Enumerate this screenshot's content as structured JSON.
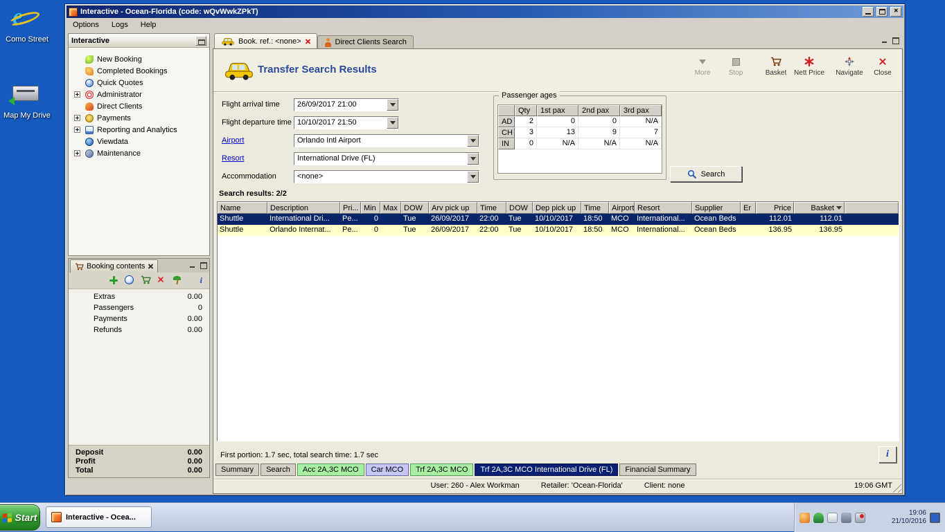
{
  "icons": {
    "info_glyph": "i"
  },
  "desktop": {
    "icons": [
      {
        "label": "Como Street"
      },
      {
        "label": "Map My Drive"
      }
    ]
  },
  "window": {
    "title": "Interactive - Ocean-Florida (code: wQvWwkZPkT)",
    "menus": [
      {
        "label": "Options"
      },
      {
        "label": "Logs"
      },
      {
        "label": "Help"
      }
    ]
  },
  "sidebar": {
    "title": "Interactive",
    "items": [
      {
        "label": "New Booking"
      },
      {
        "label": "Completed Bookings"
      },
      {
        "label": "Quick Quotes"
      },
      {
        "label": "Administrator"
      },
      {
        "label": "Direct Clients"
      },
      {
        "label": "Payments"
      },
      {
        "label": "Reporting and Analytics"
      },
      {
        "label": "Viewdata"
      },
      {
        "label": "Maintenance"
      }
    ]
  },
  "booking_panel": {
    "tab_label": "Booking contents",
    "rows": [
      {
        "label": "Extras",
        "value": "0.00"
      },
      {
        "label": "Passengers",
        "value": "0"
      },
      {
        "label": "Payments",
        "value": "0.00"
      },
      {
        "label": "Refunds",
        "value": "0.00"
      }
    ],
    "totals": [
      {
        "label": "Deposit",
        "value": "0.00"
      },
      {
        "label": "Profit",
        "value": "0.00"
      },
      {
        "label": "Total",
        "value": "0.00"
      }
    ]
  },
  "main": {
    "tabs": [
      {
        "label": "Book. ref.: <none>"
      },
      {
        "label": "Direct Clients Search"
      }
    ],
    "title": "Transfer Search Results",
    "toolbar": [
      {
        "label": "More"
      },
      {
        "label": "Stop"
      },
      {
        "label": "Basket"
      },
      {
        "label": "Nett Price"
      },
      {
        "label": "Navigate"
      },
      {
        "label": "Close"
      }
    ],
    "form": {
      "rows": [
        {
          "label": "Flight arrival time",
          "value": "26/09/2017 21:00"
        },
        {
          "label": "Flight departure time",
          "value": "10/10/2017 21:50"
        },
        {
          "label": "Airport",
          "value": "Orlando Intl Airport"
        },
        {
          "label": "Resort",
          "value": "International Drive (FL)"
        },
        {
          "label": "Accommodation",
          "value": "<none>"
        }
      ]
    },
    "passenger_ages": {
      "title": "Passenger ages",
      "columns": [
        "Qty",
        "1st pax",
        "2nd pax",
        "3rd pax"
      ],
      "rows": [
        {
          "label": "AD",
          "values": [
            "2",
            "0",
            "0",
            "N/A"
          ]
        },
        {
          "label": "CH",
          "values": [
            "3",
            "13",
            "9",
            "7"
          ]
        },
        {
          "label": "IN",
          "values": [
            "0",
            "N/A",
            "N/A",
            "N/A"
          ]
        }
      ]
    },
    "search_button": "Search",
    "results_label": "Search results: 2/2",
    "results": {
      "columns": [
        "Name",
        "Description",
        "Pri...",
        "Min",
        "Max",
        "DOW",
        "Arv pick up",
        "Time",
        "DOW",
        "Dep pick up",
        "Time",
        "Airport",
        "Resort",
        "Supplier",
        "Er",
        "Price",
        "Basket"
      ],
      "rows": [
        {
          "cells": [
            "Shuttle",
            "International Dri...",
            "Pe...",
            "0",
            "",
            "Tue",
            "26/09/2017",
            "22:00",
            "Tue",
            "10/10/2017",
            "18:50",
            "MCO",
            "International...",
            "Ocean Beds",
            "",
            "112.01",
            "112.01"
          ]
        },
        {
          "cells": [
            "Shuttle",
            "Orlando Internat...",
            "Pe...",
            "0",
            "",
            "Tue",
            "26/09/2017",
            "22:00",
            "Tue",
            "10/10/2017",
            "18:50",
            "MCO",
            "International...",
            "Ocean Beds",
            "",
            "136.95",
            "136.95"
          ]
        }
      ]
    },
    "status_text": "First portion: 1.7 sec, total search time: 1.7 sec",
    "bottom_tabs": [
      {
        "label": "Summary"
      },
      {
        "label": "Search"
      },
      {
        "label": "Acc 2A,3C MCO"
      },
      {
        "label": "Car MCO"
      },
      {
        "label": "Trf 2A,3C MCO"
      },
      {
        "label": "Trf 2A,3C MCO International Drive (FL)"
      },
      {
        "label": "Financial Summary"
      }
    ],
    "statusbar": {
      "user": "User: 260 - Alex Workman",
      "retailer": "Retailer: 'Ocean-Florida'",
      "client": "Client: none",
      "time": "19:06 GMT"
    }
  },
  "taskbar": {
    "start_label": "Start",
    "tasks": [
      {
        "label": "Interactive - Ocea..."
      }
    ],
    "clock": {
      "time": "19:06",
      "date": "21/10/2016"
    }
  }
}
